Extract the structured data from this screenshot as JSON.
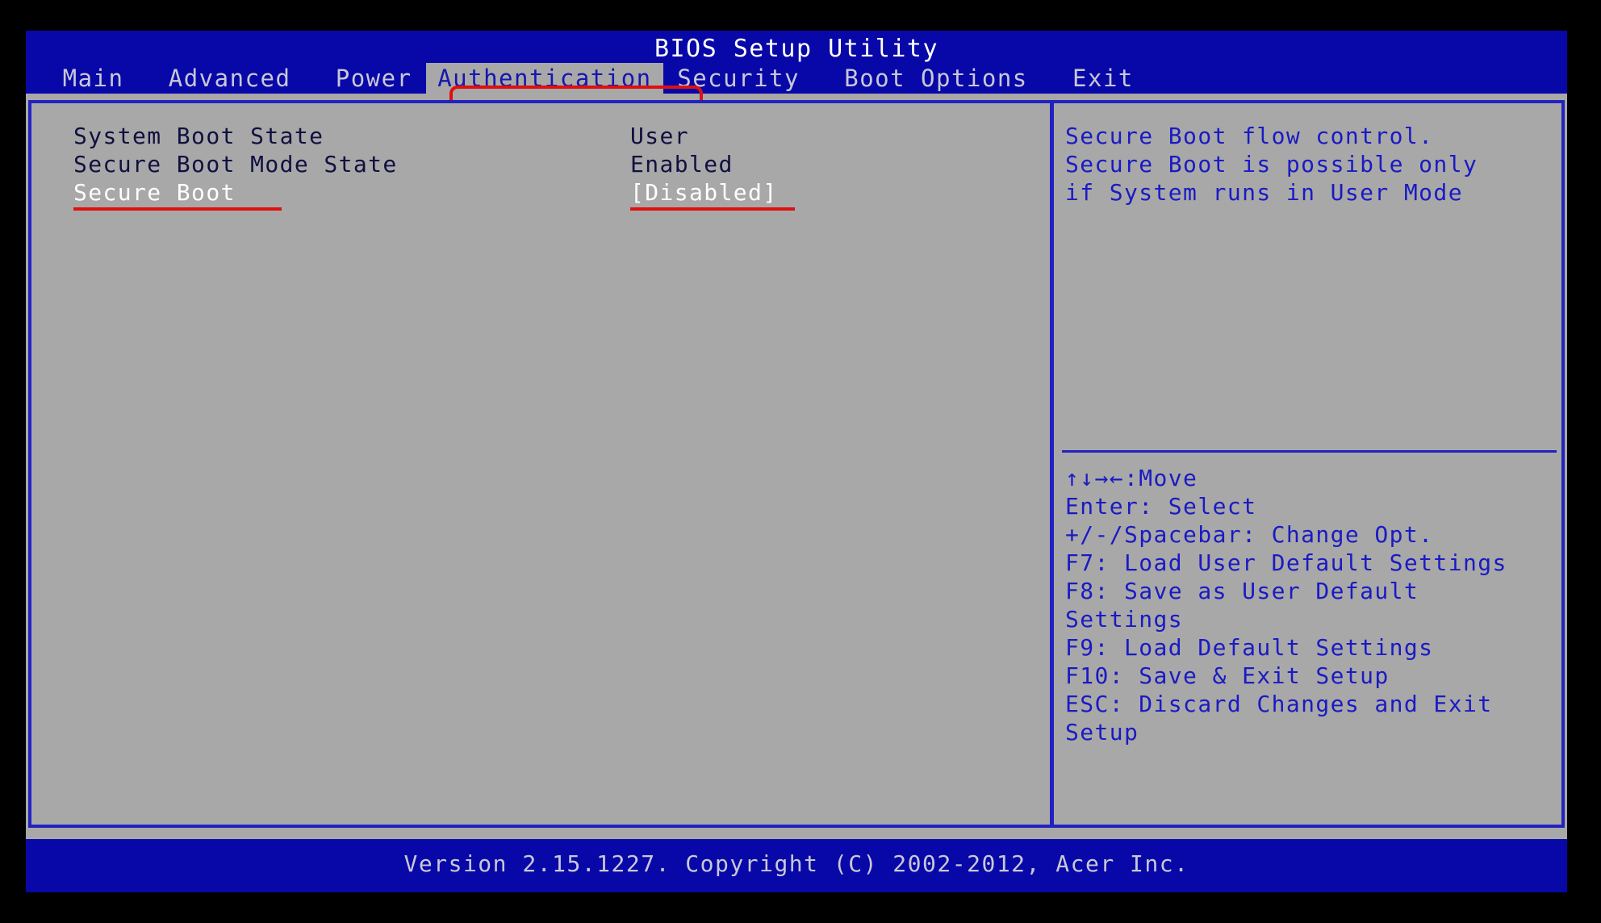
{
  "header": {
    "title": "BIOS Setup Utility",
    "tabs": [
      {
        "label": "Main",
        "active": false
      },
      {
        "label": "Advanced",
        "active": false
      },
      {
        "label": "Power",
        "active": false
      },
      {
        "label": "Authentication",
        "active": true
      },
      {
        "label": "Security",
        "active": false
      },
      {
        "label": "Boot Options",
        "active": false
      },
      {
        "label": "Exit",
        "active": false
      }
    ]
  },
  "settings": [
    {
      "label": "System Boot State",
      "value": "User",
      "selected": false,
      "annotated": false
    },
    {
      "label": "Secure Boot Mode State",
      "value": "Enabled",
      "selected": false,
      "annotated": false
    },
    {
      "label": "Secure Boot",
      "value": "[Disabled]",
      "selected": true,
      "annotated": true
    }
  ],
  "help": {
    "lines": [
      "Secure Boot flow control.",
      "Secure Boot is possible only",
      "if System runs in User Mode"
    ]
  },
  "keys": {
    "arrows_glyphs": "↑↓→←",
    "lines": [
      "↑↓→←:Move",
      "Enter: Select",
      "+/-/Spacebar: Change Opt.",
      "F7: Load User Default Settings",
      "F8: Save as User Default",
      "Settings",
      "F9: Load Default Settings",
      "F10: Save & Exit Setup",
      "ESC: Discard Changes and Exit",
      "Setup"
    ]
  },
  "footer": {
    "version_text": "Version 2.15.1227. Copyright (C) 2002-2012, Acer Inc."
  },
  "colors": {
    "header_blue": "#0808a8",
    "panel_gray": "#a8a8a8",
    "border_blue": "#2222c0",
    "text_navy": "#101040",
    "text_help_blue": "#1a1ac4",
    "text_white": "#ffffff",
    "tab_inactive": "#c8c8d8",
    "annotation_red": "#e01010"
  }
}
